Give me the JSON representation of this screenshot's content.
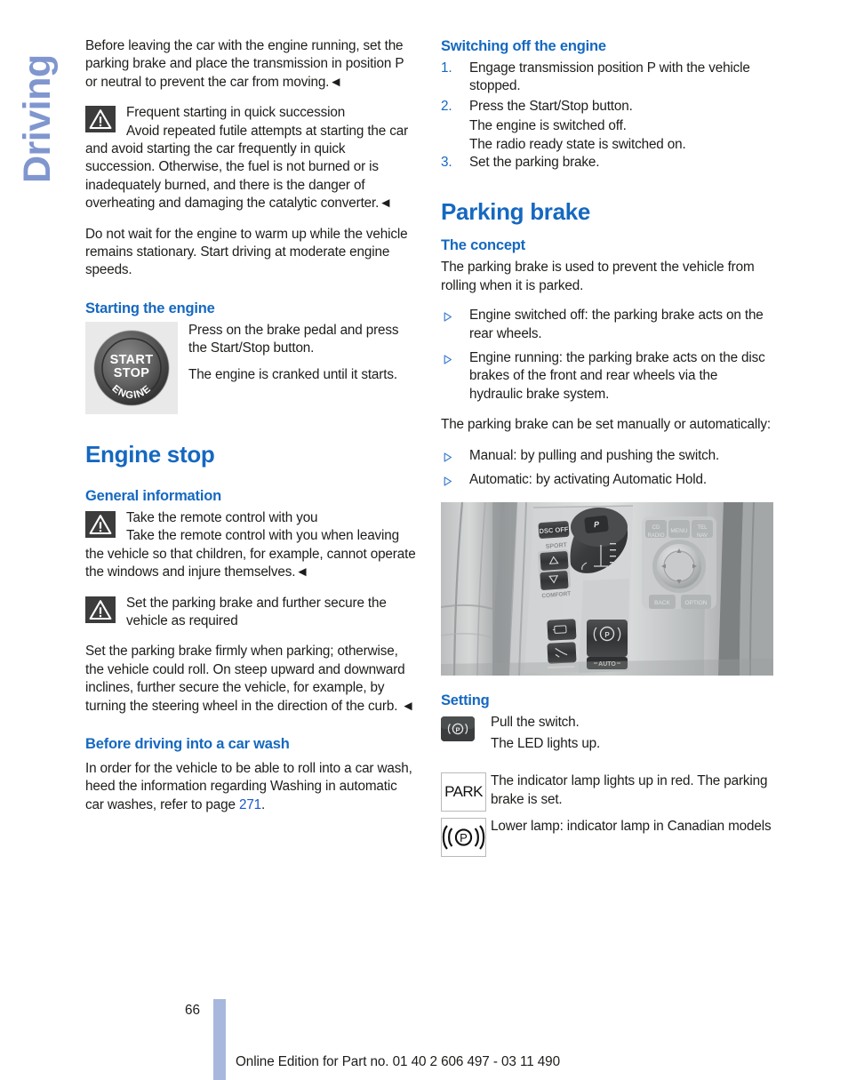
{
  "side_tab": {
    "label": "Driving"
  },
  "left_column": {
    "intro_paragraph": "Before leaving the car with the engine running, set the parking brake and place the transmission in position P or neutral to prevent the car from moving.◄",
    "warning_1": {
      "icon": "warning-triangle-icon",
      "title": "Frequent starting in quick succession",
      "body": "Avoid repeated futile attempts at starting the car and avoid starting the car frequently in quick succession. Otherwise, the fuel is not burned or is inadequately burned, and there is the danger of overheating and damaging the catalytic converter.◄"
    },
    "paragraph_warm_up": "Do not wait for the engine to warm up while the vehicle remains stationary. Start driving at moderate engine speeds.",
    "heading_starting_the_engine": "Starting the engine",
    "start_stop_button": {
      "icon": "start-stop-engine-button-icon",
      "line_1": "START",
      "line_2": "STOP",
      "line_3": "ENGINE"
    },
    "start_text_1": "Press on the brake pedal and press the Start/Stop button.",
    "start_text_2": "The engine is cranked until it starts.",
    "heading_engine_stop": "Engine stop",
    "heading_general_information": "General information",
    "warning_2": {
      "icon": "warning-triangle-icon",
      "title": "Take the remote control with you",
      "body": "Take the remote control with you when leaving the vehicle so that children, for example, cannot operate the windows and injure themselves.◄"
    },
    "warning_3": {
      "icon": "warning-triangle-icon",
      "title": "Set the parking brake and further secure the vehicle as required"
    },
    "paragraph_set_brake": "Set the parking brake firmly when parking; otherwise, the vehicle could roll. On steep upward and downward inclines, further secure the vehicle, for example, by turning the steering wheel in the direction of the curb. ◄",
    "heading_car_wash": "Before driving into a car wash",
    "car_wash_text_before": "In order for the vehicle to be able to roll into a car wash, heed the information regarding Washing in automatic car washes, refer to page ",
    "car_wash_page_ref": "271",
    "car_wash_text_after": "."
  },
  "right_column": {
    "heading_switching_off": "Switching off the engine",
    "steps": [
      {
        "num": "1.",
        "text": "Engage transmission position P with the vehicle stopped."
      },
      {
        "num": "2.",
        "text": "Press the Start/Stop button."
      },
      {
        "num": "3.",
        "text": "Set the parking brake."
      }
    ],
    "step2_sub_1": "The engine is switched off.",
    "step2_sub_2": "The radio ready state is switched on.",
    "heading_parking_brake": "Parking brake",
    "heading_the_concept": "The concept",
    "concept_paragraph": "The parking brake is used to prevent the vehicle from rolling when it is parked.",
    "concept_bullets": [
      "Engine switched off: the parking brake acts on the rear wheels.",
      "Engine running: the parking brake acts on the disc brakes of the front and rear wheels via the hydraulic brake system."
    ],
    "manual_auto_paragraph": "The parking brake can be set manually or automatically:",
    "manual_auto_bullets": [
      "Manual: by pulling and pushing the switch.",
      "Automatic: by activating Automatic Hold."
    ],
    "console_photo": {
      "icon": "center-console-photo",
      "shift_label": "P",
      "dsc_label": "DSC OFF",
      "sport_label": "SPORT",
      "comfort_label": "COMFORT",
      "auto_label": "AUTO"
    },
    "heading_setting": "Setting",
    "setting_rows": [
      {
        "icon": "parking-brake-switch-icon",
        "icon_label": "((P))",
        "line_1": "Pull the switch.",
        "line_2": "The LED lights up."
      },
      {
        "icon": "park-indicator-lamp-icon",
        "icon_label": "PARK",
        "line_1": "The indicator lamp lights up in red. The parking brake is set."
      },
      {
        "icon": "canadian-parking-brake-lamp-icon",
        "icon_label": "((P))",
        "line_1": "Lower lamp: indicator lamp in Canadian models"
      }
    ]
  },
  "footer": {
    "page_number": "66",
    "text": "Online Edition for Part no. 01 40 2 606 497 - 03 11 490"
  },
  "colors": {
    "heading_blue": "#1568c0",
    "link_blue": "#1a57d0",
    "side_tab_blue": "#8096ce",
    "footer_bar_blue": "#a8b8dc",
    "warning_icon_bg": "#3c3c3c",
    "body_text": "#1d1d1b"
  }
}
